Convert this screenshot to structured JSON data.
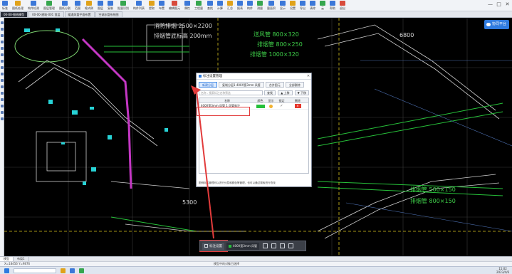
{
  "ribbon": {
    "items": [
      {
        "label": "标准",
        "cls": ""
      },
      {
        "label": "图纸处理",
        "cls": "alt"
      },
      {
        "label": "构件检测",
        "cls": ""
      },
      {
        "label": "图层管理",
        "cls": "grn"
      },
      {
        "label": "图纸分割",
        "cls": ""
      },
      {
        "label": "范围",
        "cls": ""
      },
      {
        "label": "格式刷",
        "cls": "alt"
      },
      {
        "label": "图层",
        "cls": ""
      },
      {
        "label": "复制",
        "cls": ""
      },
      {
        "label": "批量识别",
        "cls": "grn"
      },
      {
        "label": "构件列表",
        "cls": ""
      },
      {
        "label": "提取",
        "cls": "alt"
      },
      {
        "label": "布置",
        "cls": ""
      },
      {
        "label": "编辑图元",
        "cls": "red"
      },
      {
        "label": "属性",
        "cls": ""
      },
      {
        "label": "工程量",
        "cls": "grn"
      },
      {
        "label": "查找",
        "cls": ""
      },
      {
        "label": "计算",
        "cls": ""
      },
      {
        "label": "汇总",
        "cls": "alt"
      },
      {
        "label": "报表",
        "cls": ""
      },
      {
        "label": "构件",
        "cls": ""
      },
      {
        "label": "测量",
        "cls": "grn"
      },
      {
        "label": "量面积",
        "cls": ""
      },
      {
        "label": "显示",
        "cls": ""
      },
      {
        "label": "设置",
        "cls": "alt"
      },
      {
        "label": "导出",
        "cls": ""
      },
      {
        "label": "清除",
        "cls": ""
      },
      {
        "label": "云",
        "cls": "grn"
      },
      {
        "label": "帮助",
        "cls": ""
      },
      {
        "label": "退出",
        "cls": "red"
      }
    ],
    "window_controls": [
      "—",
      "□",
      "✕"
    ]
  },
  "tabs": [
    {
      "label": "00-00-图纸模型",
      "active": true
    },
    {
      "label": "00-00-建筑-001 首层",
      "active": false
    },
    {
      "label": "暖通风管平面布置",
      "active": false
    },
    {
      "label": "空调水管系统图",
      "active": false
    }
  ],
  "cloud_badge": "协同平台",
  "canvas_labels": [
    {
      "text": "消防排烟 2500×2200",
      "color": "white"
    },
    {
      "text": "排烟管底标高 200mm",
      "color": "white"
    },
    {
      "text": "送风管 800×320",
      "color": "green"
    },
    {
      "text": "排烟管 800×250",
      "color": "green"
    },
    {
      "text": "排烟管 1000×320",
      "color": "green"
    },
    {
      "text": "6800",
      "color": "white"
    },
    {
      "text": "排烟管 500×150",
      "color": "green"
    },
    {
      "text": "排烟管 800×150",
      "color": "green"
    },
    {
      "text": "5300",
      "color": "white"
    }
  ],
  "dialog": {
    "title": "标注设置管理",
    "close": "✕",
    "tabs": [
      {
        "label": "新建分层",
        "active": true
      },
      {
        "label": "复制分层1 400X宽3mm 风管",
        "active": false
      },
      {
        "label": "合并图元",
        "active": false
      },
      {
        "label": "全部删除",
        "active": false
      }
    ],
    "search_placeholder": "名称 - 搜索标注名称筛选",
    "search_button": "查找",
    "move_up": "▲ 上移",
    "move_down": "▼ 下移",
    "columns": {
      "name": "名称",
      "color": "颜色",
      "show": "显示",
      "lock": "锁定",
      "delete": "删除"
    },
    "rows": [
      {
        "name": "400X宽3mm 风管 1 风管标注",
        "check": "✓",
        "delete_mark": "✕"
      }
    ],
    "hint": "图例标注管理可以进行分层和颜色等管理，也可以通过搜索进行查找"
  },
  "floatbar": {
    "button_label": "标注设置",
    "layer_label": "400X宽3mm 风管"
  },
  "sheettabs": [
    {
      "label": "模型",
      "active": true
    },
    {
      "label": "布局1",
      "active": false
    }
  ],
  "status": {
    "coords": "X=18456 Y=9876",
    "middle": "模型中的对象已选择"
  },
  "clock": {
    "time": "15:02",
    "date": "2023/4/6"
  }
}
